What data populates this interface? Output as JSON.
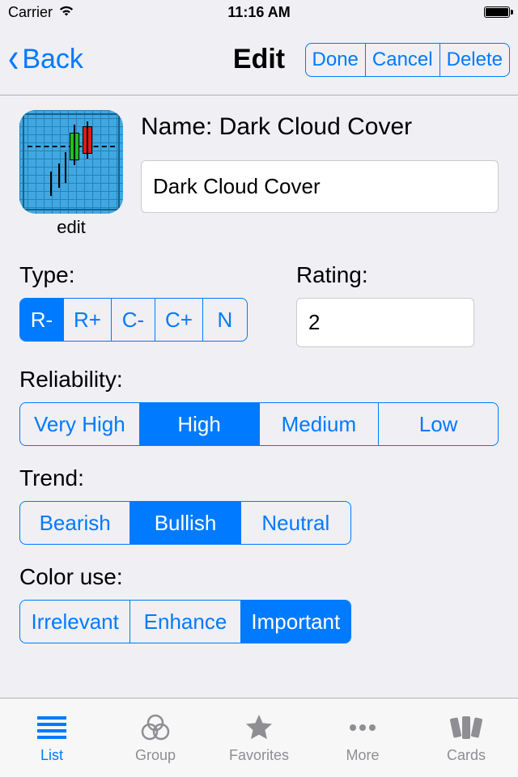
{
  "status": {
    "carrier": "Carrier",
    "time": "11:16 AM"
  },
  "nav": {
    "back": "Back",
    "title": "Edit",
    "done": "Done",
    "cancel": "Cancel",
    "delete": "Delete"
  },
  "thumb": {
    "edit_label": "edit"
  },
  "name": {
    "label_prefix": "Name: ",
    "label_value": "Dark Cloud Cover",
    "input_value": "Dark Cloud Cover"
  },
  "type": {
    "label": "Type:",
    "options": [
      "R-",
      "R+",
      "C-",
      "C+",
      "N"
    ],
    "selected": 0
  },
  "rating": {
    "label": "Rating:",
    "value": "2"
  },
  "reliability": {
    "label": "Reliability:",
    "options": [
      "Very High",
      "High",
      "Medium",
      "Low"
    ],
    "selected": 1
  },
  "trend": {
    "label": "Trend:",
    "options": [
      "Bearish",
      "Bullish",
      "Neutral"
    ],
    "selected": 1
  },
  "color_use": {
    "label": "Color use:",
    "options": [
      "Irrelevant",
      "Enhance",
      "Important"
    ],
    "selected": 2
  },
  "tabs": {
    "items": [
      {
        "label": "List"
      },
      {
        "label": "Group"
      },
      {
        "label": "Favorites"
      },
      {
        "label": "More"
      },
      {
        "label": "Cards"
      }
    ],
    "selected": 0
  }
}
